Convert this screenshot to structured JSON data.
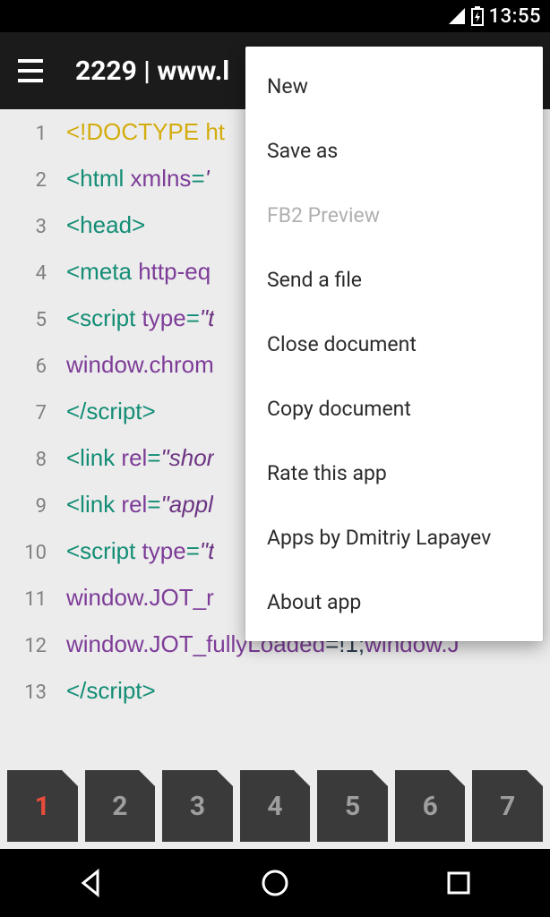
{
  "status": {
    "time": "13:55"
  },
  "appbar": {
    "title": "2229 | www.l"
  },
  "editor": {
    "lines": [
      {
        "n": "1",
        "segments": [
          {
            "cls": "c-keyword",
            "t": "<!DOCTYPE ht"
          }
        ]
      },
      {
        "n": "2",
        "segments": [
          {
            "cls": "c-tag",
            "t": "<html "
          },
          {
            "cls": "c-attr",
            "t": "xmlns"
          },
          {
            "cls": "c-tag",
            "t": "="
          },
          {
            "cls": "c-str",
            "t": "'"
          }
        ]
      },
      {
        "n": "3",
        "segments": [
          {
            "cls": "c-tag",
            "t": "<head>"
          }
        ]
      },
      {
        "n": "4",
        "segments": [
          {
            "cls": "c-tag",
            "t": "<meta "
          },
          {
            "cls": "c-attr",
            "t": "http-eq"
          }
        ]
      },
      {
        "n": "5",
        "segments": [
          {
            "cls": "c-tag",
            "t": "<script "
          },
          {
            "cls": "c-attr",
            "t": "type"
          },
          {
            "cls": "c-tag",
            "t": "="
          },
          {
            "cls": "c-str",
            "t": "\"t"
          }
        ]
      },
      {
        "n": "6",
        "segments": [
          {
            "cls": "c-ident",
            "t": "window.chrom"
          }
        ]
      },
      {
        "n": "7",
        "segments": [
          {
            "cls": "c-tag",
            "t": "</script>"
          }
        ]
      },
      {
        "n": "8",
        "segments": [
          {
            "cls": "c-tag",
            "t": "<link "
          },
          {
            "cls": "c-attr",
            "t": "rel"
          },
          {
            "cls": "c-tag",
            "t": "="
          },
          {
            "cls": "c-str",
            "t": "\"shor"
          }
        ]
      },
      {
        "n": "9",
        "segments": [
          {
            "cls": "c-tag",
            "t": "<link "
          },
          {
            "cls": "c-attr",
            "t": "rel"
          },
          {
            "cls": "c-tag",
            "t": "="
          },
          {
            "cls": "c-str",
            "t": "\"appl"
          }
        ]
      },
      {
        "n": "10",
        "segments": [
          {
            "cls": "c-tag",
            "t": "<script "
          },
          {
            "cls": "c-attr",
            "t": "type"
          },
          {
            "cls": "c-tag",
            "t": "="
          },
          {
            "cls": "c-str",
            "t": "\"t"
          }
        ]
      },
      {
        "n": "11",
        "segments": [
          {
            "cls": "c-ident",
            "t": "window.JOT_r"
          }
        ]
      },
      {
        "n": "12",
        "segments": [
          {
            "cls": "c-ident",
            "t": "window.JOT_fullyLoaded"
          },
          {
            "cls": "c-plain",
            "t": "=!1;"
          },
          {
            "cls": "c-ident",
            "t": "window.J"
          }
        ]
      },
      {
        "n": "13",
        "segments": [
          {
            "cls": "c-tag",
            "t": "</script>"
          }
        ]
      }
    ]
  },
  "tabs": {
    "items": [
      {
        "label": "1",
        "active": true
      },
      {
        "label": "2"
      },
      {
        "label": "3"
      },
      {
        "label": "4"
      },
      {
        "label": "5"
      },
      {
        "label": "6"
      },
      {
        "label": "7"
      }
    ]
  },
  "menu": {
    "items": [
      {
        "label": "New",
        "disabled": false
      },
      {
        "label": "Save as",
        "disabled": false
      },
      {
        "label": "FB2 Preview",
        "disabled": true
      },
      {
        "label": "Send a file",
        "disabled": false
      },
      {
        "label": "Close document",
        "disabled": false
      },
      {
        "label": "Copy document",
        "disabled": false
      },
      {
        "label": "Rate this app",
        "disabled": false
      },
      {
        "label": "Apps by Dmitriy Lapayev",
        "disabled": false
      },
      {
        "label": "About app",
        "disabled": false
      }
    ]
  }
}
